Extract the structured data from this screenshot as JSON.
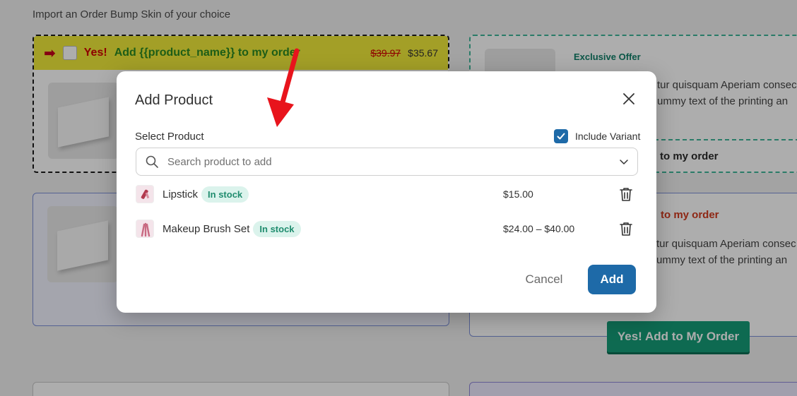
{
  "background": {
    "heading": "Import an Order Bump Skin of your choice",
    "skin1": {
      "yes_label": "Yes!",
      "add_label": "Add {{product_name}} to my order",
      "old_price": "$39.97",
      "new_price": "$35.67"
    },
    "skin2": {
      "exclusive_label": "Exclusive Offer",
      "desc_line1": "tur quisquam Aperiam consec",
      "desc_line2": "ummy text of the printing an",
      "cta": "to my order"
    },
    "skin4": {
      "add_line": "to my order",
      "desc_line1": "tur quisquam Aperiam consec",
      "desc_line2": "ummy text of the printing an",
      "button": "Yes! Add to My Order"
    }
  },
  "modal": {
    "title": "Add Product",
    "select_label": "Select Product",
    "include_variant_label": "Include Variant",
    "include_variant_checked": true,
    "search_placeholder": "Search product to add",
    "products": [
      {
        "name": "Lipstick",
        "stock": "In stock",
        "price": "$15.00"
      },
      {
        "name": "Makeup Brush Set",
        "stock": "In stock",
        "price": "$24.00 – $40.00"
      }
    ],
    "cancel_label": "Cancel",
    "add_label": "Add"
  },
  "colors": {
    "primary": "#1e6aa8",
    "stock_badge_bg": "#dbf3ec",
    "stock_badge_text": "#1f8c6e",
    "annotation_arrow": "#e8141c"
  },
  "icons": {
    "close": "close-icon",
    "search": "search-icon",
    "chevron": "chevron-down-icon",
    "delete": "trash-icon",
    "checkbox": "check-icon"
  }
}
